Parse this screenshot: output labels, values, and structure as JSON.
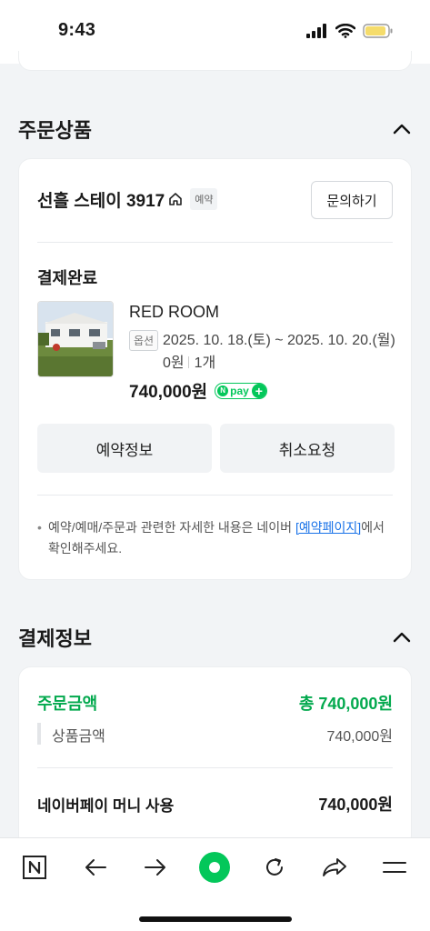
{
  "status_bar": {
    "time": "9:43"
  },
  "order_section": {
    "title": "주문상품",
    "store_name": "선흘 스테이 3917",
    "reserve_tag": "예약",
    "inquiry_label": "문의하기",
    "payment_status": "결제완료",
    "room_name": "RED ROOM",
    "option_tag": "옵션",
    "option_dates": "2025. 10. 18.(토) ~ 2025. 10. 20.(월) 0원",
    "quantity": "1개",
    "price": "740,000원",
    "npay_label": "pay",
    "reservation_info_label": "예약정보",
    "cancel_request_label": "취소요청",
    "notice_before": "예약/예매/주문과 관련한 자세한 내용은 네이버 ",
    "notice_link": "[예약페이지]",
    "notice_after": "에서 확인해주세요."
  },
  "payment_section": {
    "title": "결제정보",
    "order_amount_label": "주문금액",
    "order_amount_value": "총 740,000원",
    "product_amount_label": "상품금액",
    "product_amount_value": "740,000원",
    "naverpay_money_label": "네이버페이 머니 사용",
    "naverpay_money_value": "740,000원"
  },
  "colors": {
    "accent": "#03c75a",
    "link": "#1a73e8"
  },
  "bottom_nav": {
    "icons": [
      "naver-n-icon",
      "back-arrow-icon",
      "forward-arrow-icon",
      "green-dot-icon",
      "refresh-icon",
      "share-icon",
      "menu-icon"
    ]
  }
}
